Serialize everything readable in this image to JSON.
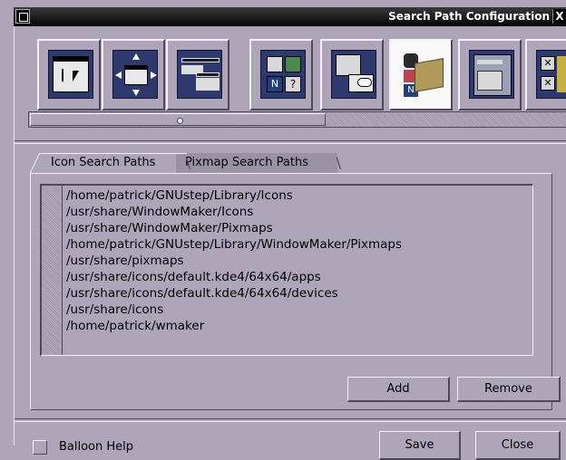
{
  "window": {
    "title": "Search Path Configuration",
    "close_glyph": "X"
  },
  "toolbar_icons": [
    "window-focus-icon",
    "window-placement-icon",
    "window-handling-icon",
    "menu-preferences-icon",
    "icon-preferences-icon",
    "search-path-icon",
    "workspace-preferences-icon",
    "other-preferences-icon"
  ],
  "tabs": {
    "icon_search_paths": "Icon Search Paths",
    "pixmap_search_paths": "Pixmap Search Paths"
  },
  "paths": [
    "/home/patrick/GNUstep/Library/Icons",
    "/usr/share/WindowMaker/Icons",
    "/usr/share/WindowMaker/Pixmaps",
    "/home/patrick/GNUstep/Library/WindowMaker/Pixmaps",
    "/usr/share/pixmaps",
    "/usr/share/icons/default.kde4/64x64/apps",
    "/usr/share/icons/default.kde4/64x64/devices",
    "/usr/share/icons",
    "/home/patrick/wmaker"
  ],
  "buttons": {
    "add": "Add",
    "remove": "Remove",
    "save": "Save",
    "close": "Close"
  },
  "balloon_help": {
    "label": "Balloon Help",
    "checked": false
  }
}
